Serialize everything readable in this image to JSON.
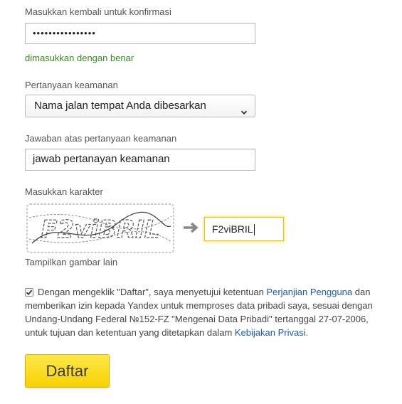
{
  "confirm": {
    "label": "Masukkan kembali untuk konfirmasi",
    "value": "••••••••••••••••",
    "status": "dimasukkan dengan benar"
  },
  "security_question": {
    "label": "Pertanyaan keamanan",
    "selected": "Nama jalan tempat Anda dibesarkan",
    "icon": "chevron-down-icon"
  },
  "security_answer": {
    "label": "Jawaban atas pertanyaan keamanan",
    "value": "jawab pertanayan keamanan"
  },
  "captcha": {
    "label": "Masukkan karakter",
    "image_text": "F2viBRIL",
    "input_value": "F2viBRIL",
    "refresh_label": "Tampilkan gambar lain",
    "arrow_icon": "arrow-right-icon"
  },
  "agreement": {
    "checked": true,
    "text_1": "Dengan mengeklik \"Daftar\", saya menyetujui ketentuan ",
    "link_1": "Perjanjian Pengguna",
    "text_2": " dan memberikan izin kepada Yandex untuk memproses data pribadi saya, sesuai dengan Undang-Undang Federal №152-FZ \"Mengenai Data Pribadi\" tertanggal 27-07-2006, untuk tujuan dan ketentuan yang ditetapkan dalam ",
    "link_2": "Kebijakan Privasi",
    "text_3": "."
  },
  "submit": {
    "label": "Daftar"
  },
  "colors": {
    "accent": "#f8d200",
    "link": "#1a58b8",
    "success": "#3a8a1d"
  }
}
